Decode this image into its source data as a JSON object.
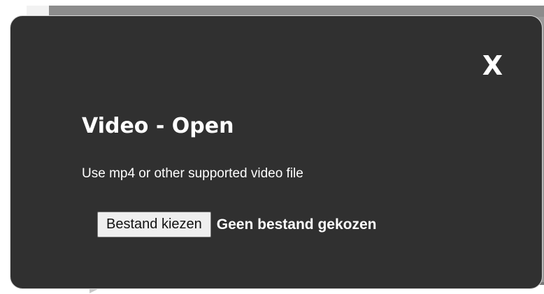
{
  "dialog": {
    "close_label": "X",
    "title": "Video - Open",
    "description": "Use mp4 or other supported video file",
    "file_input": {
      "button_label": "Bestand kiezen",
      "status_text": "Geen bestand gekozen"
    }
  },
  "colors": {
    "modal_background": "#303030",
    "modal_border": "#d8d8d8",
    "text": "#ffffff",
    "file_button_background": "#efefef"
  }
}
